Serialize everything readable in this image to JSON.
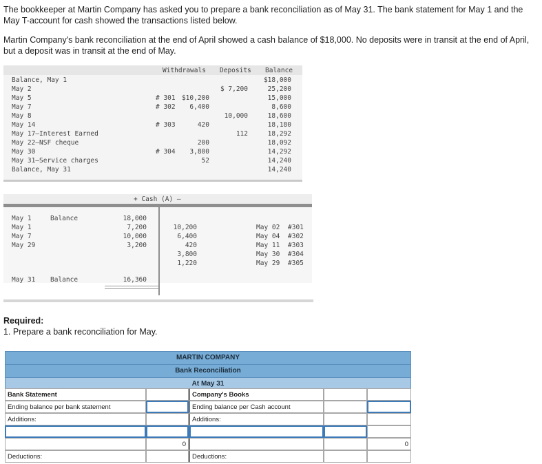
{
  "intro": {
    "p1": "The bookkeeper at Martin Company has asked you to prepare a bank reconciliation as of May 31. The bank statement for May 1 and the May T-account for cash showed the transactions listed below.",
    "p2": "Martin Company's bank reconciliation at the end of April showed a cash balance of $18,000. No deposits were in transit at the end of April, but a deposit was in transit at the end of May."
  },
  "bank_statement": {
    "headers": {
      "withdrawals": "Withdrawals",
      "deposits": "Deposits",
      "balance": "Balance"
    },
    "rows": [
      {
        "label": "Balance, May 1",
        "chk": "",
        "wd": "",
        "dep": "",
        "bal": "$18,000"
      },
      {
        "label": "May 2",
        "chk": "",
        "wd": "",
        "dep": "$ 7,200",
        "bal": "25,200"
      },
      {
        "label": "May 5",
        "chk": "# 301",
        "wd": "$10,200",
        "dep": "",
        "bal": "15,000"
      },
      {
        "label": "May 7",
        "chk": "# 302",
        "wd": "6,400",
        "dep": "",
        "bal": "8,600"
      },
      {
        "label": "May 8",
        "chk": "",
        "wd": "",
        "dep": "10,000",
        "bal": "18,600"
      },
      {
        "label": "May 14",
        "chk": "# 303",
        "wd": "420",
        "dep": "",
        "bal": "18,180"
      },
      {
        "label": "May 17–Interest Earned",
        "chk": "",
        "wd": "",
        "dep": "112",
        "bal": "18,292"
      },
      {
        "label": "May 22–NSF cheque",
        "chk": "",
        "wd": "200",
        "dep": "",
        "bal": "18,092"
      },
      {
        "label": "May 30",
        "chk": "# 304",
        "wd": "3,800",
        "dep": "",
        "bal": "14,292"
      },
      {
        "label": "May 31–Service charges",
        "chk": "",
        "wd": "52",
        "dep": "",
        "bal": "14,240"
      },
      {
        "label": "Balance, May 31",
        "chk": "",
        "wd": "",
        "dep": "",
        "bal": "14,240"
      }
    ]
  },
  "t_account": {
    "title": "+ Cash (A) –",
    "debits": [
      {
        "date": "May 1",
        "desc": "Balance",
        "amt": "18,000"
      },
      {
        "date": "May 1",
        "desc": "",
        "amt": "7,200"
      },
      {
        "date": "May 7",
        "desc": "",
        "amt": "10,000"
      },
      {
        "date": "May 29",
        "desc": "",
        "amt": "3,200"
      }
    ],
    "credits": [
      {
        "amt": "10,200",
        "date": "May 02",
        "chk": "#301"
      },
      {
        "amt": "6,400",
        "date": "May 04",
        "chk": "#302"
      },
      {
        "amt": "420",
        "date": "May 11",
        "chk": "#303"
      },
      {
        "amt": "3,800",
        "date": "May 30",
        "chk": "#304"
      },
      {
        "amt": "1,220",
        "date": "May 29",
        "chk": "#305"
      }
    ],
    "ending": {
      "date": "May 31",
      "desc": "Balance",
      "amt": "16,360"
    }
  },
  "required": {
    "heading": "Required:",
    "item1": "1. Prepare a bank reconciliation for May."
  },
  "reconciliation": {
    "company": "MARTIN COMPANY",
    "title": "Bank Reconciliation",
    "date": "At May 31",
    "left": {
      "section": "Bank Statement",
      "ending_label": "Ending balance per bank statement",
      "additions_label": "Additions:",
      "subtotal": "0",
      "deductions_label": "Deductions:"
    },
    "right": {
      "section": "Company's Books",
      "ending_label": "Ending balance per Cash account",
      "additions_label": "Additions:",
      "subtotal": "0",
      "deductions_label": "Deductions:"
    }
  }
}
